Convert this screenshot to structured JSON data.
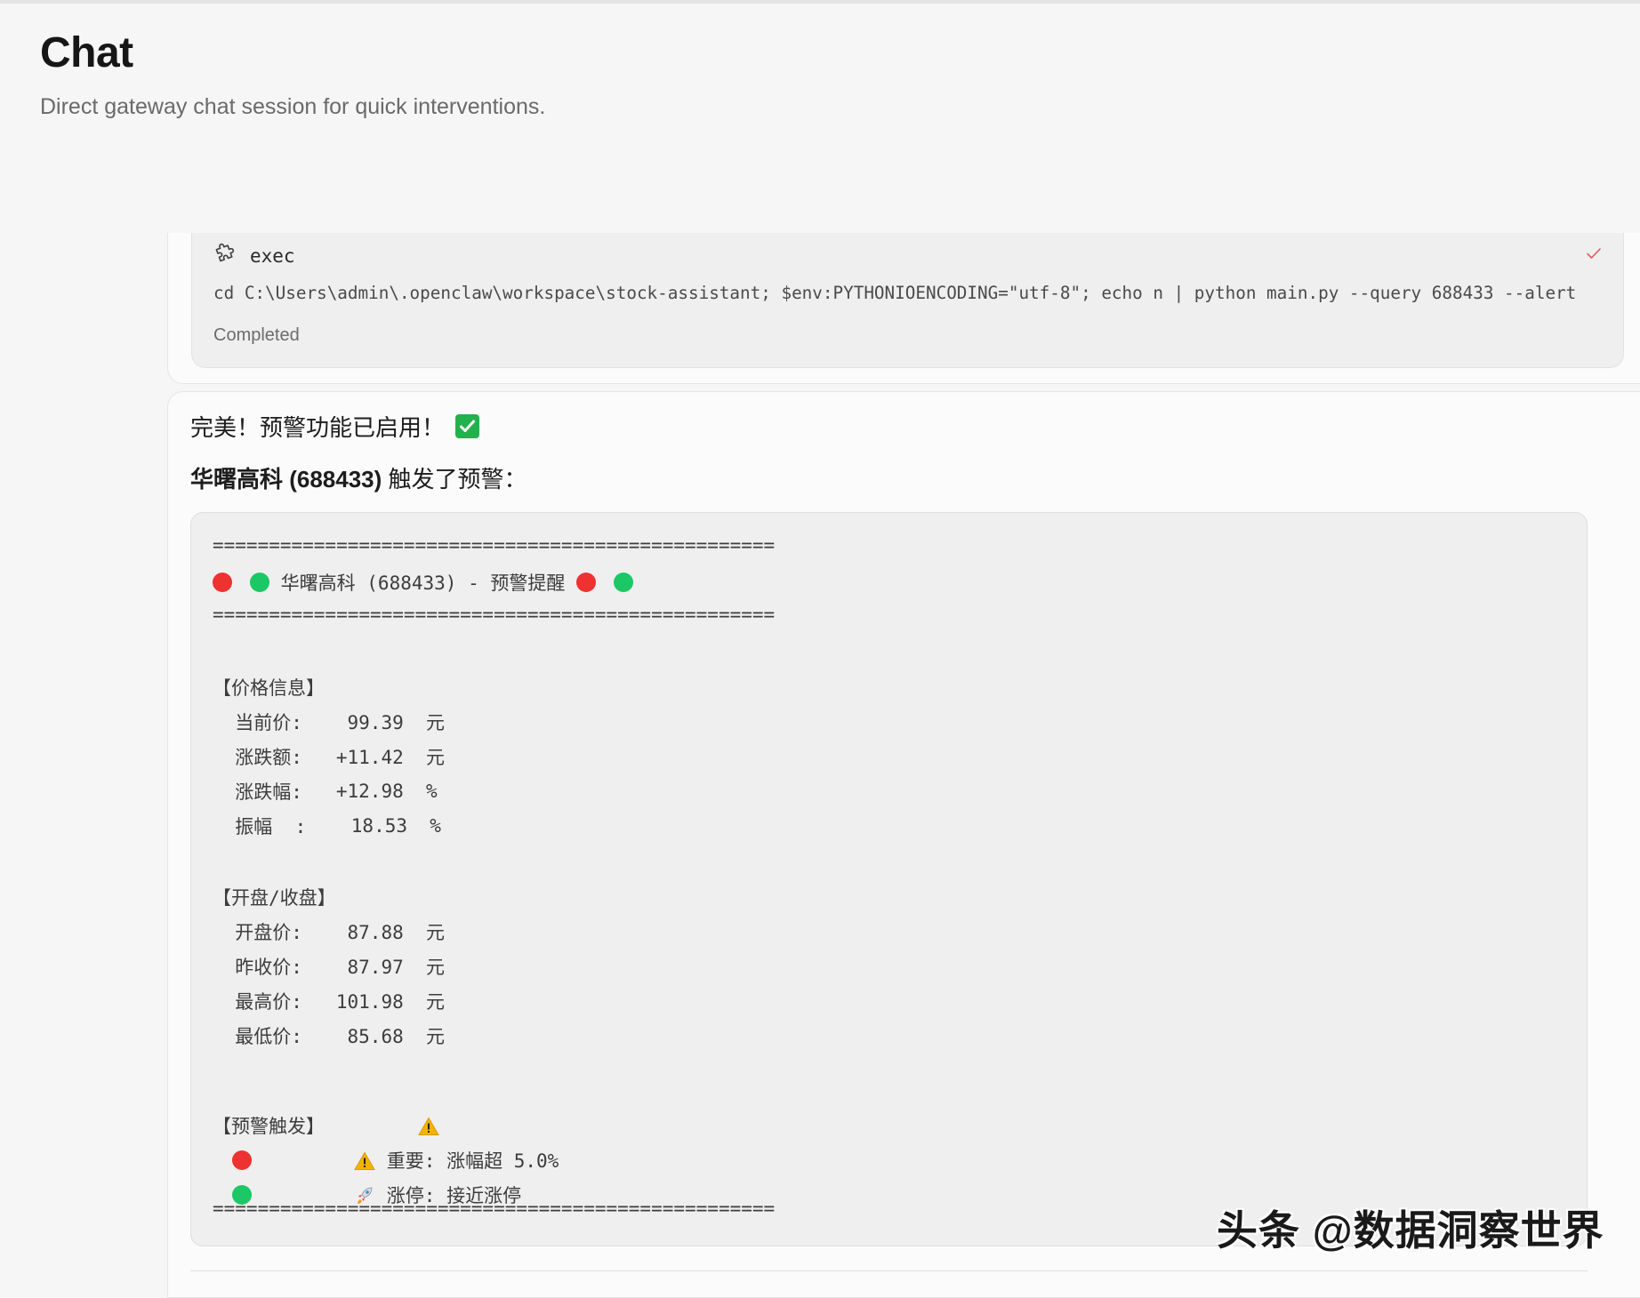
{
  "header": {
    "title": "Chat",
    "subtitle": "Direct gateway chat session for quick interventions."
  },
  "tool_call": {
    "icon": "puzzle-icon",
    "name": "exec",
    "command": "cd C:\\Users\\admin\\.openclaw\\workspace\\stock-assistant; $env:PYTHONIOENCODING=\"utf-8\"; echo n | python main.py --query 688433 --alert",
    "status": "Completed",
    "status_icon": "check-icon",
    "accent_color": "#e05a5a"
  },
  "assistant_message": {
    "line1": "完美！预警功能已启用！",
    "line1_icon": "check-box-icon",
    "line2_bold": "华曙高科 (688433)",
    "line2_rest": " 触发了预警：",
    "code": {
      "rule": "==================================================",
      "title": " 华曙高科 (688433) - 预警提醒 ",
      "price_section": "【价格信息】",
      "price_rows": [
        {
          "label": "  当前价:",
          "value": "    99.39  元"
        },
        {
          "label": "  涨跌额:",
          "value": "   +11.42  元"
        },
        {
          "label": "  涨跌幅:",
          "value": "   +12.98  %"
        },
        {
          "label": "  振幅  :",
          "value": "    18.53  %"
        }
      ],
      "open_section": "【开盘/收盘】",
      "open_rows": [
        {
          "label": "  开盘价:",
          "value": "    87.88  元"
        },
        {
          "label": "  昨收价:",
          "value": "    87.97  元"
        },
        {
          "label": "  最高价:",
          "value": "   101.98  元"
        },
        {
          "label": "  最低价:",
          "value": "    85.68  元"
        }
      ],
      "alert_section": "【预警触发】",
      "alert_rows": [
        {
          "text": " 重要: 涨幅超 5.0%",
          "dot": "red",
          "icon": "warning-icon"
        },
        {
          "text": " 涨停: 接近涨停",
          "dot": "green",
          "icon": "rocket-icon"
        }
      ]
    }
  },
  "watermark": "头条 @数据洞察世界",
  "colors": {
    "red_dot": "#ee3131",
    "green_dot": "#1cc865",
    "check_green": "#22b24c",
    "warning_yellow": "#f2b400"
  }
}
